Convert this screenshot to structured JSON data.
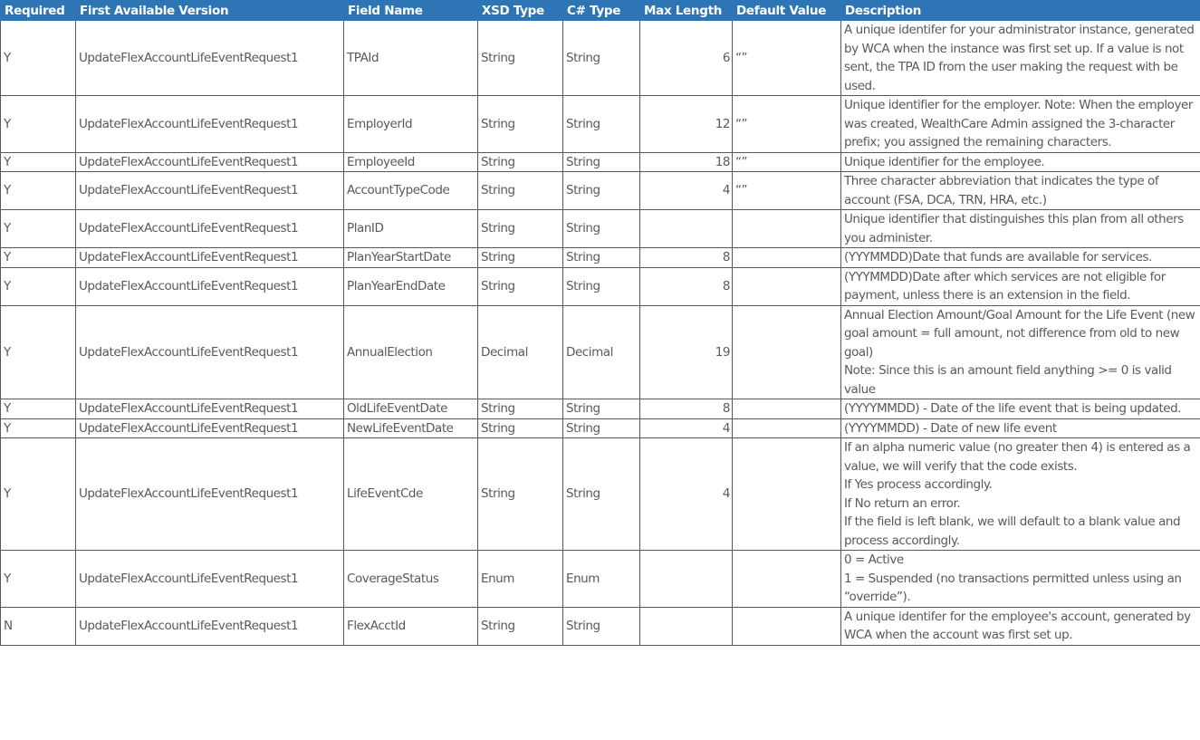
{
  "headers": [
    "Required",
    "First Available Version",
    "Field Name",
    "XSD Type",
    "C# Type",
    "Max Length",
    "Default Value",
    "Description"
  ],
  "rows": [
    {
      "required": "Y",
      "version": "UpdateFlexAccountLifeEventRequest1",
      "field": "TPAId",
      "xsd": "String",
      "cs": "String",
      "max": "6",
      "default": "“”",
      "desc": [
        "A unique identifer for your administrator instance, generated by WCA when the instance was first set up. If a value is not sent, the TPA ID from the user making the request with be used."
      ]
    },
    {
      "required": "Y",
      "version": "UpdateFlexAccountLifeEventRequest1",
      "field": "EmployerId",
      "xsd": "String",
      "cs": "String",
      "max": "12",
      "default": "“”",
      "desc": [
        "Unique identifier for the employer. Note: When the employer was created, WealthCare Admin assigned the 3-character prefix; you assigned the remaining characters."
      ]
    },
    {
      "required": "Y",
      "version": "UpdateFlexAccountLifeEventRequest1",
      "field": "EmployeeId",
      "xsd": "String",
      "cs": "String",
      "max": "18",
      "default": "“”",
      "desc": [
        "Unique identifier for the employee."
      ]
    },
    {
      "required": "Y",
      "version": "UpdateFlexAccountLifeEventRequest1",
      "field": "AccountTypeCode",
      "xsd": "String",
      "cs": "String",
      "max": "4",
      "default": "“”",
      "desc": [
        "Three character abbreviation that indicates the type of account (FSA, DCA, TRN, HRA, etc.)"
      ]
    },
    {
      "required": "Y",
      "version": "UpdateFlexAccountLifeEventRequest1",
      "field": "PlanID",
      "xsd": "String",
      "cs": "String",
      "max": "",
      "default": "",
      "desc": [
        "Unique identifier that distinguishes this plan from all others you administer."
      ]
    },
    {
      "required": "Y",
      "version": "UpdateFlexAccountLifeEventRequest1",
      "field": "PlanYearStartDate",
      "xsd": "String",
      "cs": "String",
      "max": "8",
      "default": "",
      "desc": [
        "(YYYMMDD)Date that funds are available for services."
      ]
    },
    {
      "required": "Y",
      "version": "UpdateFlexAccountLifeEventRequest1",
      "field": "PlanYearEndDate",
      "xsd": "String",
      "cs": "String",
      "max": "8",
      "default": "",
      "desc": [
        "(YYYMMDD)Date after which services are not eligible for payment, unless there is an extension in the field."
      ]
    },
    {
      "required": "Y",
      "version": "UpdateFlexAccountLifeEventRequest1",
      "field": "AnnualElection",
      "xsd": "Decimal",
      "cs": "Decimal",
      "max": "19",
      "default": "",
      "desc": [
        "Annual Election Amount/Goal Amount for the Life Event (new goal amount = full amount, not difference from old to new goal)",
        "Note: Since this is an amount field anything >= 0 is valid value"
      ]
    },
    {
      "required": "Y",
      "version": "UpdateFlexAccountLifeEventRequest1",
      "field": "OldLifeEventDate",
      "xsd": "String",
      "cs": "String",
      "max": "8",
      "default": "",
      "desc": [
        "(YYYYMMDD) - Date of the life event that is being updated."
      ]
    },
    {
      "required": "Y",
      "version": "UpdateFlexAccountLifeEventRequest1",
      "field": "NewLifeEventDate",
      "xsd": "String",
      "cs": "String",
      "max": "4",
      "default": "",
      "desc": [
        "(YYYYMMDD) - Date of new life event"
      ]
    },
    {
      "required": "Y",
      "version": "UpdateFlexAccountLifeEventRequest1",
      "field": "LifeEventCde",
      "xsd": "String",
      "cs": "String",
      "max": "4",
      "default": "",
      "desc": [
        "If an alpha numeric value (no greater then 4) is entered as a value, we will verify that the code exists.",
        "If Yes process accordingly.",
        "If No return an error.",
        "If the field is left blank, we will default to a blank value and process accordingly."
      ]
    },
    {
      "required": "Y",
      "version": "UpdateFlexAccountLifeEventRequest1",
      "field": "CoverageStatus",
      "xsd": "Enum",
      "cs": "Enum",
      "max": "",
      "default": "",
      "desc": [
        "0 = Active",
        "1 = Suspended (no transactions permitted unless using an “override”)."
      ]
    },
    {
      "required": "N",
      "version": "UpdateFlexAccountLifeEventRequest1",
      "field": "FlexAcctId",
      "xsd": "String",
      "cs": "String",
      "max": "",
      "default": "",
      "desc": [
        "A unique identifer for the employee's account, generated by WCA when the account was first set up."
      ]
    }
  ]
}
